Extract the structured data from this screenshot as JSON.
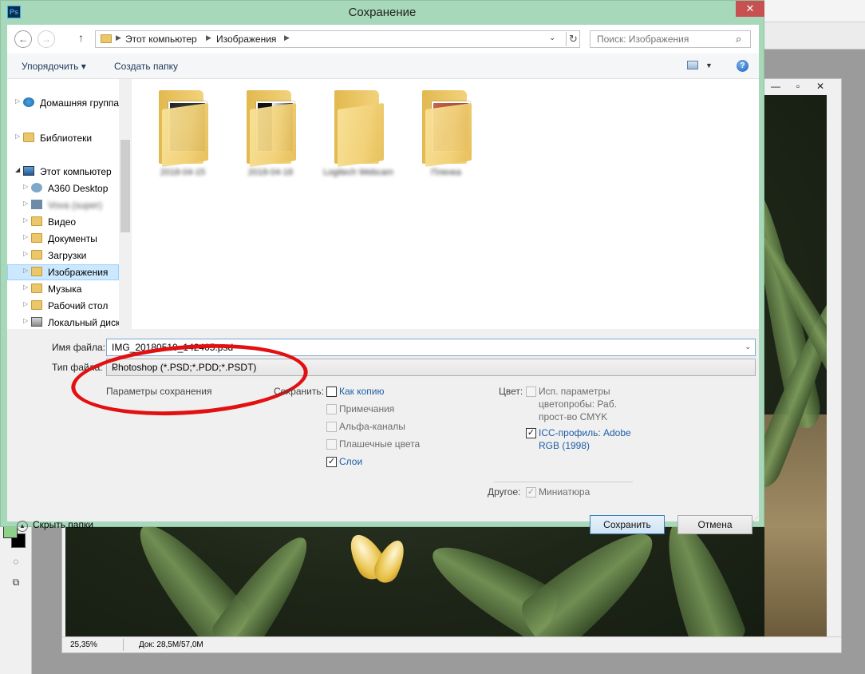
{
  "dialog": {
    "title": "Сохранение",
    "app_icon_text": "Ps",
    "close_glyph": "✕"
  },
  "address": {
    "crumbs": [
      "Этот компьютер",
      "Изображения"
    ],
    "search_placeholder": "Поиск: Изображения"
  },
  "command_bar": {
    "organize": "Упорядочить ▾",
    "new_folder": "Создать папку"
  },
  "nav_pane": {
    "homegroup": "Домашняя группа",
    "libraries": "Библиотеки",
    "this_pc": "Этот компьютер",
    "items": [
      "A360 Desktop",
      "Vova (super)",
      "Видео",
      "Документы",
      "Загрузки",
      "Изображения",
      "Музыка",
      "Рабочий стол",
      "Локальный диск"
    ],
    "selected": "Изображения"
  },
  "folders": [
    {
      "name": "2018-04-15",
      "thumb": "#2a2a2a"
    },
    {
      "name": "2018-04-18",
      "thumb": "#1a1a1a"
    },
    {
      "name": "Logitech Webcam",
      "thumb": ""
    },
    {
      "name": "Пленка",
      "thumb": "#b0503a"
    }
  ],
  "form": {
    "filename_label": "Имя файла:",
    "filename_value": "IMG_20180510_142405.psd",
    "filetype_label": "Тип файла:",
    "filetype_value": "Photoshop (*.PSD;*.PDD;*.PSDT)",
    "params_label": "Параметры сохранения"
  },
  "save_options": {
    "label": "Сохранить:",
    "items": [
      {
        "text": "Как копию",
        "checked": false,
        "enabled": true
      },
      {
        "text": "Примечания",
        "checked": false,
        "enabled": false
      },
      {
        "text": "Альфа-каналы",
        "checked": false,
        "enabled": false
      },
      {
        "text": "Плашечные цвета",
        "checked": false,
        "enabled": false
      },
      {
        "text": "Слои",
        "checked": true,
        "enabled": true
      }
    ]
  },
  "color_options": {
    "label": "Цвет:",
    "proof_line1": "Исп. параметры",
    "proof_line2": "цветопробы:  Раб.",
    "proof_line3": "прост-во CMYK",
    "icc_line1": "ICC-профиль:  Adobe",
    "icc_line2": "RGB (1998)",
    "other_label": "Другое:",
    "thumbnail": "Миниатюра"
  },
  "buttons": {
    "hide_folders": "Скрыть папки",
    "save": "Сохранить",
    "cancel": "Отмена"
  },
  "photoshop": {
    "zoom": "25,35%",
    "doc_info": "Док: 28,5M/57,0M",
    "minimize_glyph": "—",
    "restore_glyph": "▫",
    "close_glyph": "✕"
  },
  "colors": {
    "dialog_frame": "#a6d8b9",
    "close_red": "#c75050",
    "selection": "#cce8ff",
    "link_blue": "#1f5fa8",
    "annotation_red": "#e21010"
  }
}
